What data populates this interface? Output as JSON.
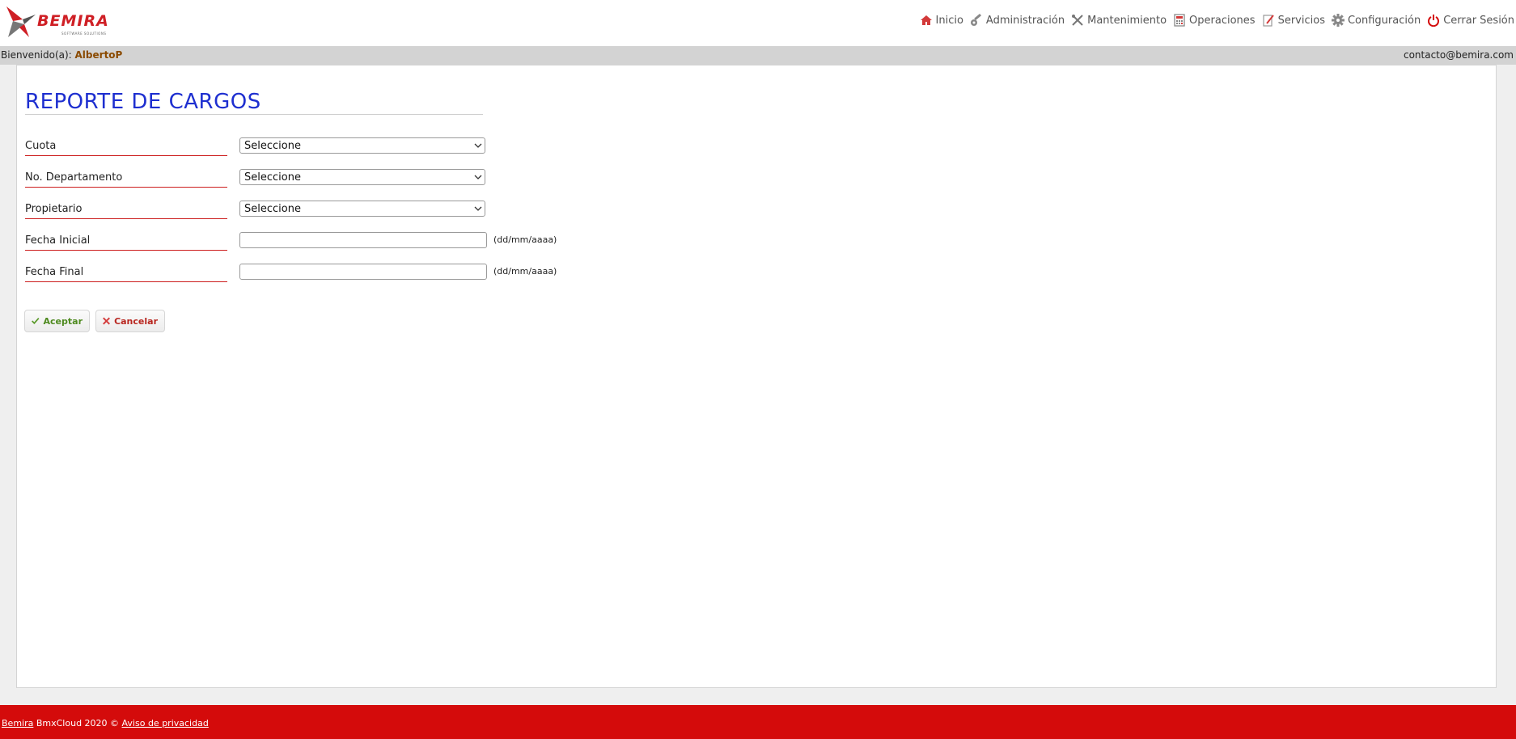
{
  "brand": {
    "name": "BEMIRA",
    "tagline": "SOFTWARE SOLUTIONS",
    "accent_color": "#cf1f25"
  },
  "nav": {
    "items": [
      {
        "label": "Inicio",
        "icon": "home-icon"
      },
      {
        "label": "Administración",
        "icon": "key-icon"
      },
      {
        "label": "Mantenimiento",
        "icon": "tools-icon"
      },
      {
        "label": "Operaciones",
        "icon": "calculator-icon"
      },
      {
        "label": "Servicios",
        "icon": "edit-document-icon"
      },
      {
        "label": "Configuración",
        "icon": "gear-icon"
      },
      {
        "label": "Cerrar Sesión",
        "icon": "power-icon"
      }
    ]
  },
  "welcome": {
    "prefix": "Bienvenido(a): ",
    "user": "AlbertoP",
    "email": "contacto@bemira.com"
  },
  "page": {
    "title": "REPORTE DE CARGOS",
    "title_color": "#1e2fd0"
  },
  "form": {
    "fields": [
      {
        "label": "Cuota",
        "type": "select",
        "value": "Seleccione"
      },
      {
        "label": "No. Departamento",
        "type": "select",
        "value": "Seleccione"
      },
      {
        "label": "Propietario",
        "type": "select",
        "value": "Seleccione"
      },
      {
        "label": "Fecha Inicial",
        "type": "text",
        "value": "",
        "hint": "(dd/mm/aaaa)"
      },
      {
        "label": "Fecha Final",
        "type": "text",
        "value": "",
        "hint": "(dd/mm/aaaa)"
      }
    ],
    "accept_label": "Aceptar",
    "cancel_label": "Cancelar"
  },
  "footer": {
    "brand_link": "Bemira",
    "copyright": " BmxCloud 2020 © ",
    "privacy_link": "Aviso de privacidad",
    "background": "#d40b0b"
  }
}
